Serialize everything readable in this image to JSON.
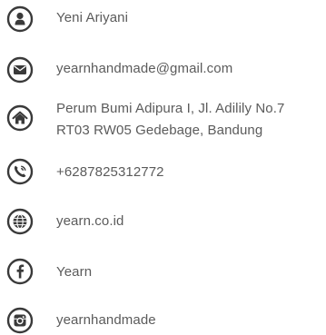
{
  "contacts": {
    "name": "Yeni Ariyani",
    "email": "yearnhandmade@gmail.com",
    "address_line1": "Perum Bumi Adipura I,  Jl. Adilily No.7",
    "address_line2": "RT03 RW05 Gedebage,  Bandung",
    "phone": "+6287825312772",
    "website": "yearn.co.id",
    "facebook": "Yearn",
    "instagram": "yearnhandmade"
  },
  "icons": {
    "name": "user-icon",
    "email": "envelope-icon",
    "address": "home-icon",
    "phone": "phone-icon",
    "website": "globe-icon",
    "facebook": "facebook-icon",
    "instagram": "instagram-icon"
  },
  "colors": {
    "icon": "#3a3a3a",
    "text": "#5b5b5b",
    "background": "#ffffff"
  }
}
